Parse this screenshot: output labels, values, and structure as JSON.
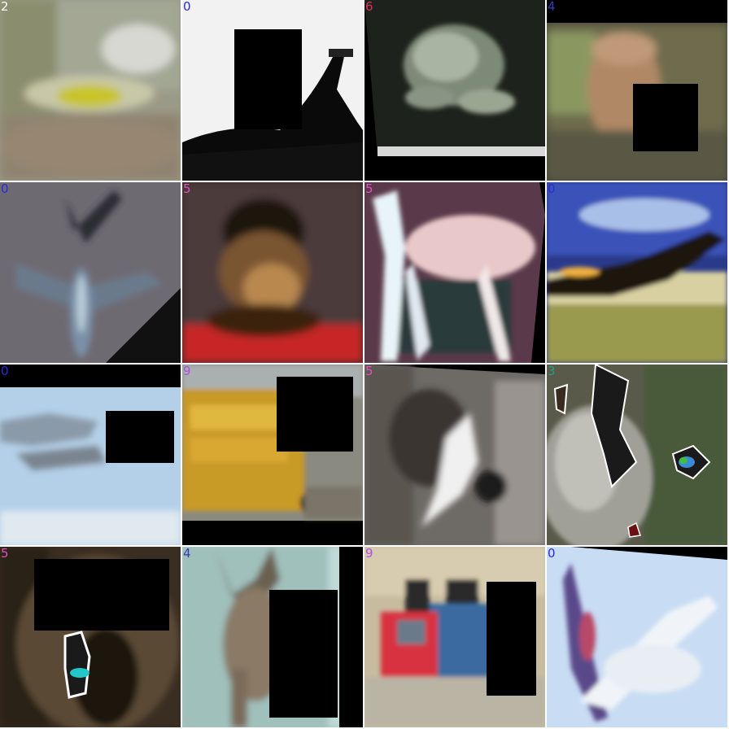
{
  "tiles": [
    {
      "label": "2",
      "label_color": "#ffffff",
      "content": "bird"
    },
    {
      "label": "0",
      "label_color": "#2a2ad8",
      "content": "airplane"
    },
    {
      "label": "6",
      "label_color": "#e0305a",
      "content": "frog"
    },
    {
      "label": "4",
      "label_color": "#3a3ab0",
      "content": "deer"
    },
    {
      "label": "0",
      "label_color": "#2a2ad8",
      "content": "airplane"
    },
    {
      "label": "5",
      "label_color": "#e050c0",
      "content": "dog"
    },
    {
      "label": "5",
      "label_color": "#e050c0",
      "content": "dog"
    },
    {
      "label": "0",
      "label_color": "#2a2ad8",
      "content": "airplane"
    },
    {
      "label": "0",
      "label_color": "#2a2ad8",
      "content": "airplane"
    },
    {
      "label": "9",
      "label_color": "#b050e0",
      "content": "truck"
    },
    {
      "label": "5",
      "label_color": "#e050c0",
      "content": "dog"
    },
    {
      "label": "3",
      "label_color": "#20a080",
      "content": "cat"
    },
    {
      "label": "5",
      "label_color": "#e050c0",
      "content": "dog"
    },
    {
      "label": "4",
      "label_color": "#3a3ab0",
      "content": "deer"
    },
    {
      "label": "9",
      "label_color": "#b050e0",
      "content": "truck"
    },
    {
      "label": "0",
      "label_color": "#2a2ad8",
      "content": "airplane"
    }
  ]
}
